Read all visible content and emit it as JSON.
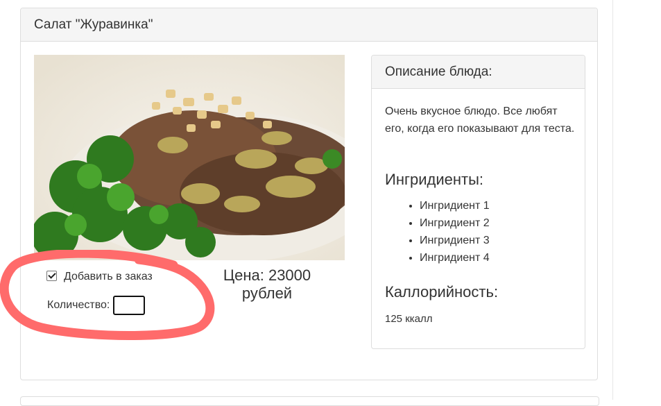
{
  "dish": {
    "title": "Салат \"Журавинка\"",
    "photo_icon": "salad-photo",
    "add_to_order_label": "Добавить в заказ",
    "add_to_order_checked": true,
    "quantity_label": "Количество:",
    "quantity_value": "",
    "price_line1": "Цена: 23000",
    "price_line2": "рублей"
  },
  "description": {
    "heading": "Описание блюда:",
    "text": "Очень вкусное блюдо. Все любят его, когда его показывают для теста.",
    "ingredients_title": "Ингридиенты:",
    "ingredients": [
      "Ингридиент 1",
      "Ингридиент 2",
      "Ингридиент 3",
      "Ингридиент 4"
    ],
    "calories_title": "Каллорийность:",
    "calories_value": "125 ккалл"
  },
  "colors": {
    "highlight": "#ff6b6b",
    "panel_border": "#dddddd",
    "panel_heading_bg": "#f5f5f5"
  }
}
